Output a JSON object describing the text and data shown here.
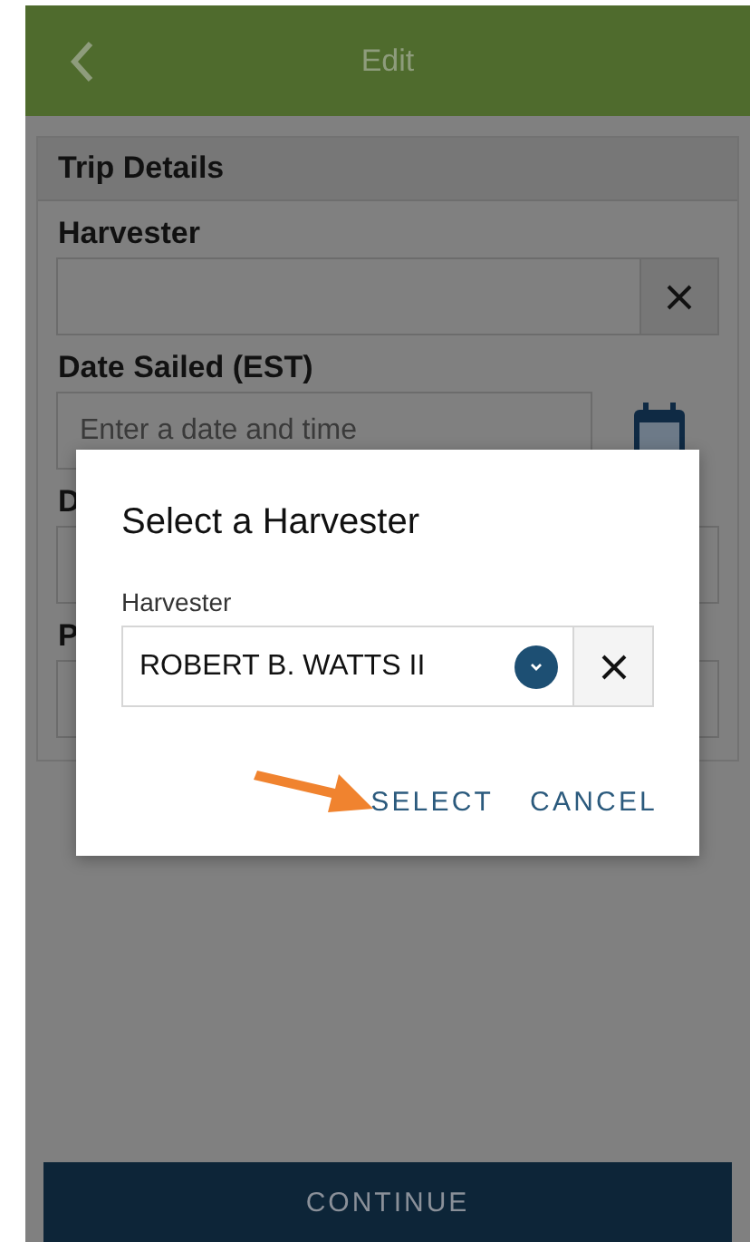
{
  "header": {
    "title": "Edit"
  },
  "section": {
    "title": "Trip Details",
    "fields": [
      {
        "label": "Harvester",
        "kind": "clearable"
      },
      {
        "label": "Date Sailed (EST)",
        "kind": "date",
        "placeholder": "Enter a date and time"
      },
      {
        "label": "D",
        "kind": "text"
      },
      {
        "label": "P",
        "kind": "text"
      }
    ]
  },
  "dialog": {
    "title": "Select a Harvester",
    "field_label": "Harvester",
    "value": "ROBERT B. WATTS II",
    "buttons": [
      "SELECT",
      "CANCEL"
    ]
  },
  "continue_button": "CONTINUE"
}
